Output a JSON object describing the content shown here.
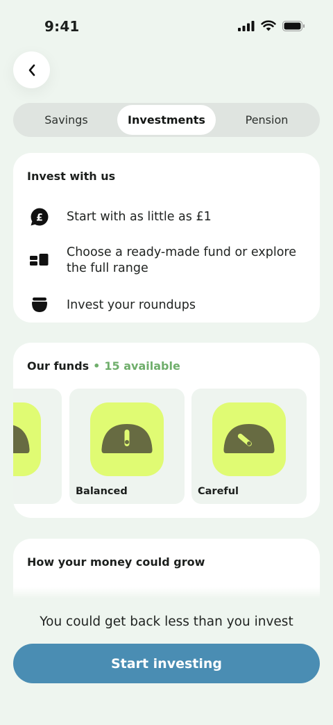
{
  "status_bar": {
    "time": "9:41"
  },
  "tabs": [
    {
      "label": "Savings",
      "active": false
    },
    {
      "label": "Investments",
      "active": true
    },
    {
      "label": "Pension",
      "active": false
    }
  ],
  "invest_card": {
    "heading": "Invest with us",
    "features": [
      {
        "icon": "pound-coin-icon",
        "text": "Start with as little as £1"
      },
      {
        "icon": "fund-blocks-icon",
        "text": "Choose a ready-made fund or explore the full range"
      },
      {
        "icon": "pot-icon",
        "text": "Invest your roundups"
      }
    ]
  },
  "funds_card": {
    "heading": "Our funds",
    "separator": "•",
    "count_text": "15 available",
    "funds": [
      {
        "name": "s",
        "icon": "speedometer-icon"
      },
      {
        "name": "Balanced",
        "icon": "speedometer-icon"
      },
      {
        "name": "Careful",
        "icon": "speedometer-icon"
      }
    ]
  },
  "grow_card": {
    "heading": "How your money could grow"
  },
  "footer": {
    "disclaimer": "You could get back less than you invest",
    "cta_label": "Start investing"
  },
  "colors": {
    "background": "#eef5ef",
    "accent_green": "#6fae6b",
    "fund_tile_bg": "#e0fb73",
    "dial_color": "#676b42",
    "cta": "#4a8db3"
  }
}
